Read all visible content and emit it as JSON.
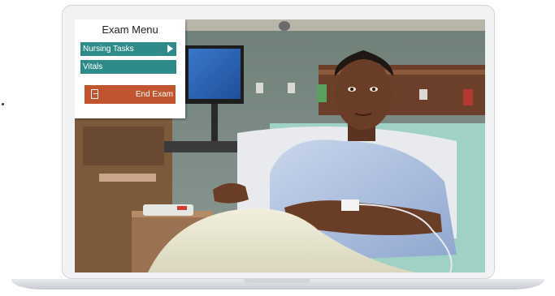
{
  "exam_menu": {
    "title": "Exam Menu",
    "nursing_tasks_label": "Nursing Tasks",
    "vitals_label": "Vitals",
    "end_exam_label": "End Exam"
  },
  "colors": {
    "menu_button": "#2f8b8a",
    "end_exam_button": "#c2542f",
    "menu_background": "#ffffff"
  },
  "icons": {
    "submenu_arrow": "chevron-right-icon",
    "end_exam": "exit-door-icon"
  }
}
